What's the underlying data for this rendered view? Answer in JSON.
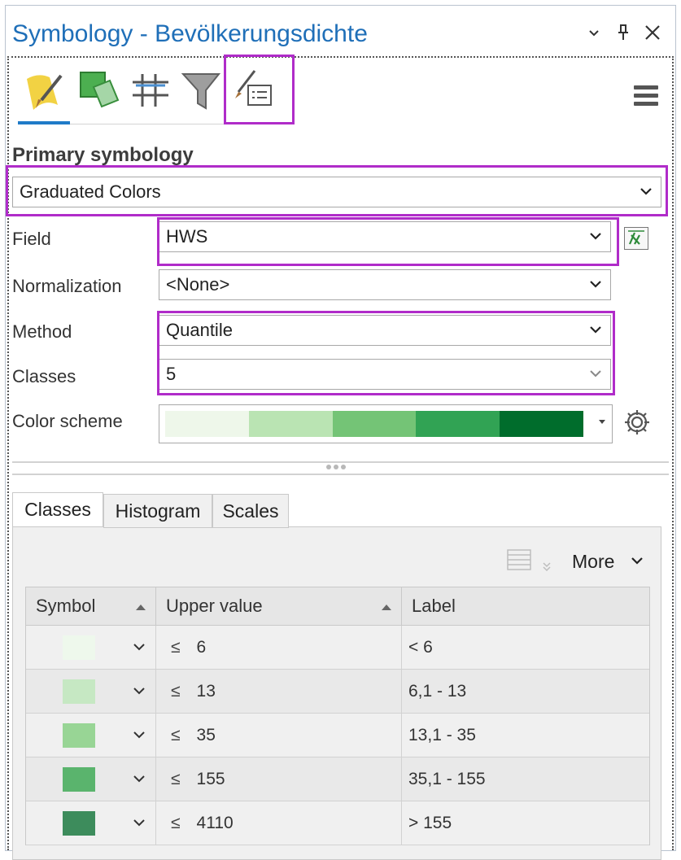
{
  "window": {
    "title": "Symbology - Bevölkerungsdichte"
  },
  "toolbar_icons": [
    "primary-symbology-icon",
    "vary-symbology-icon",
    "symbol-layers-icon",
    "display-filters-icon",
    "label-classes-icon"
  ],
  "primary_symbology": {
    "heading": "Primary symbology",
    "type_value": "Graduated Colors"
  },
  "fields": {
    "field_label": "Field",
    "field_value": "HWS",
    "normalization_label": "Normalization",
    "normalization_value": "<None>",
    "method_label": "Method",
    "method_value": "Quantile",
    "classes_label": "Classes",
    "classes_value": "5",
    "color_scheme_label": "Color scheme",
    "color_scheme": [
      "#eef7ea",
      "#bae4b3",
      "#74c476",
      "#31a354",
      "#006d2c"
    ]
  },
  "panel_tabs": [
    "Classes",
    "Histogram",
    "Scales"
  ],
  "more_label": "More",
  "table": {
    "headers": [
      "Symbol",
      "Upper value",
      "Label"
    ],
    "rows": [
      {
        "color": "#eef8ec",
        "upper": "6",
        "label": "< 6"
      },
      {
        "color": "#c6e8c3",
        "upper": "13",
        "label": "6,1 - 13"
      },
      {
        "color": "#98d595",
        "upper": "35",
        "label": "13,1 - 35"
      },
      {
        "color": "#5ab46d",
        "upper": "155",
        "label": "35,1 - 155"
      },
      {
        "color": "#3d8c5c",
        "upper": "4110",
        "label": "> 155"
      }
    ],
    "le_symbol": "≤"
  },
  "highlight_color": "#b02cc9"
}
